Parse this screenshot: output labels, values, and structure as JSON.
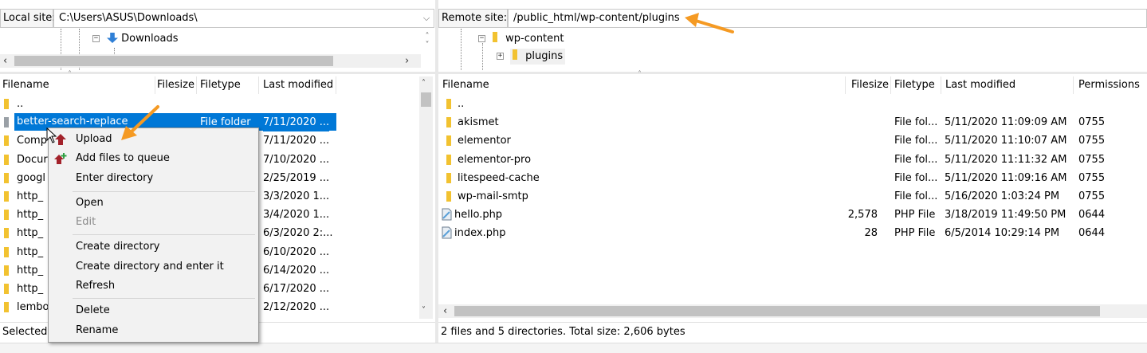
{
  "local": {
    "site_label": "Local site:",
    "path": "C:\\Users\\ASUS\\Downloads\\",
    "tree_item": "Downloads",
    "columns": {
      "filename": "Filename",
      "filesize": "Filesize",
      "filetype": "Filetype",
      "modified": "Last modified"
    },
    "rows": [
      {
        "name": "..",
        "type": "",
        "modified": ""
      },
      {
        "name": "better-search-replace",
        "type": "File folder",
        "modified": "7/11/2020 ...",
        "selected": true
      },
      {
        "name": "Comp",
        "type": "",
        "modified": "7/11/2020 ..."
      },
      {
        "name": "Docur",
        "type": "",
        "modified": "7/10/2020 ..."
      },
      {
        "name": "googl",
        "type": "",
        "modified": "2/25/2019 ..."
      },
      {
        "name": "http_",
        "type": "",
        "modified": "3/3/2020 1..."
      },
      {
        "name": "http_",
        "type": "",
        "modified": "3/4/2020 1..."
      },
      {
        "name": "http_",
        "type": "",
        "modified": "6/3/2020 2:..."
      },
      {
        "name": "http_",
        "type": "",
        "modified": "6/10/2020 ..."
      },
      {
        "name": "http_",
        "type": "",
        "modified": "6/14/2020 ..."
      },
      {
        "name": "http_",
        "type": "",
        "modified": "6/17/2020 ..."
      },
      {
        "name": "lembo",
        "type": "",
        "modified": "2/12/2020 ..."
      }
    ],
    "status": "Selected 1"
  },
  "remote": {
    "site_label": "Remote site:",
    "path": "/public_html/wp-content/plugins",
    "tree_items": [
      "wp-content",
      "plugins"
    ],
    "columns": {
      "filename": "Filename",
      "filesize": "Filesize",
      "filetype": "Filetype",
      "modified": "Last modified",
      "permissions": "Permissions"
    },
    "rows": [
      {
        "name": "..",
        "size": "",
        "type": "",
        "modified": "",
        "perm": ""
      },
      {
        "name": "akismet",
        "size": "",
        "type": "File fol...",
        "modified": "5/11/2020 11:09:09 AM",
        "perm": "0755"
      },
      {
        "name": "elementor",
        "size": "",
        "type": "File fol...",
        "modified": "5/11/2020 11:10:07 AM",
        "perm": "0755"
      },
      {
        "name": "elementor-pro",
        "size": "",
        "type": "File fol...",
        "modified": "5/11/2020 11:11:32 AM",
        "perm": "0755"
      },
      {
        "name": "litespeed-cache",
        "size": "",
        "type": "File fol...",
        "modified": "5/11/2020 11:09:16 AM",
        "perm": "0755"
      },
      {
        "name": "wp-mail-smtp",
        "size": "",
        "type": "File fol...",
        "modified": "5/16/2020 1:03:24 PM",
        "perm": "0755"
      },
      {
        "name": "hello.php",
        "size": "2,578",
        "type": "PHP File",
        "modified": "3/18/2019 11:49:50 PM",
        "perm": "0644"
      },
      {
        "name": "index.php",
        "size": "28",
        "type": "PHP File",
        "modified": "6/5/2014 10:29:14 PM",
        "perm": "0644"
      }
    ],
    "status": "2 files and 5 directories. Total size: 2,606 bytes"
  },
  "context_menu": {
    "upload": "Upload",
    "add_to_queue": "Add files to queue",
    "enter_directory": "Enter directory",
    "open": "Open",
    "edit": "Edit",
    "create_directory": "Create directory",
    "create_and_enter": "Create directory and enter it",
    "refresh": "Refresh",
    "delete": "Delete",
    "rename": "Rename"
  },
  "colors": {
    "selection": "#0078d7",
    "annotation_arrow": "#f59a23",
    "folder": "#f2c230"
  },
  "icons": [
    "folder-icon",
    "upload-icon",
    "add-queue-icon",
    "php-file-icon",
    "dropdown-icon",
    "scroll-arrow-icon"
  ]
}
